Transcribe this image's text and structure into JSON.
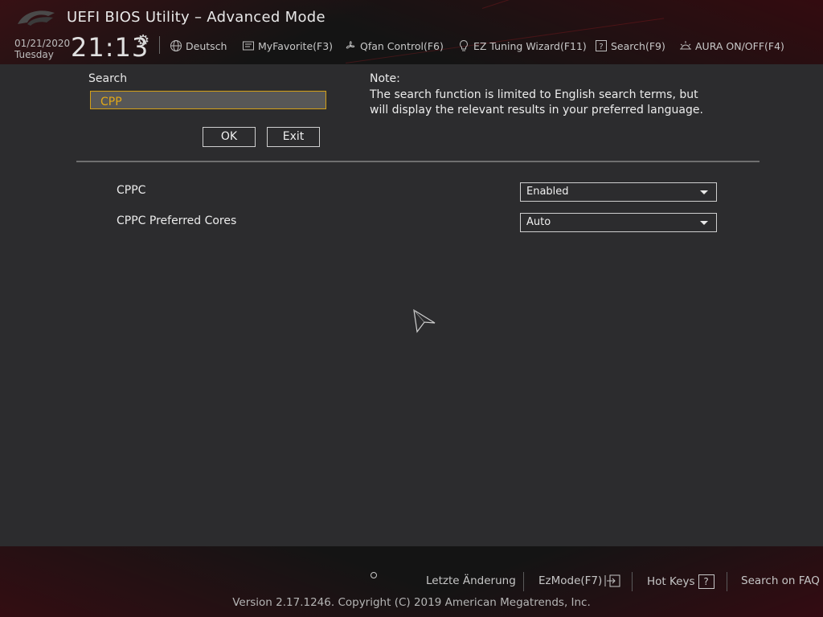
{
  "header": {
    "title": "UEFI BIOS Utility – Advanced Mode",
    "date": "01/21/2020",
    "weekday": "Tuesday",
    "time": "21:13",
    "nav": {
      "language": "Deutsch",
      "myfavorite": "MyFavorite(F3)",
      "qfan": "Qfan Control(F6)",
      "ez_tuning": "EZ Tuning Wizard(F11)",
      "search": "Search(F9)",
      "aura": "AURA ON/OFF(F4)"
    }
  },
  "search": {
    "label": "Search",
    "value": "CPP",
    "ok_label": "OK",
    "exit_label": "Exit"
  },
  "note": {
    "title": "Note:",
    "text": "The search function is limited to English search terms, but will display the relevant results in your preferred language."
  },
  "settings": [
    {
      "label": "CPPC",
      "value": "Enabled"
    },
    {
      "label": "CPPC Preferred Cores",
      "value": "Auto"
    }
  ],
  "footer": {
    "last_changed": "Letzte Änderung",
    "ezmode": "EzMode(F7)",
    "hotkeys": "Hot Keys",
    "hotkeys_key": "?",
    "faq": "Search on FAQ",
    "version": "Version 2.17.1246. Copyright (C) 2019 American Megatrends, Inc."
  },
  "colors": {
    "accent": "#d4a017",
    "background": "#2c2c2e",
    "header": "#141414",
    "brand_red": "#8a0f1a"
  }
}
